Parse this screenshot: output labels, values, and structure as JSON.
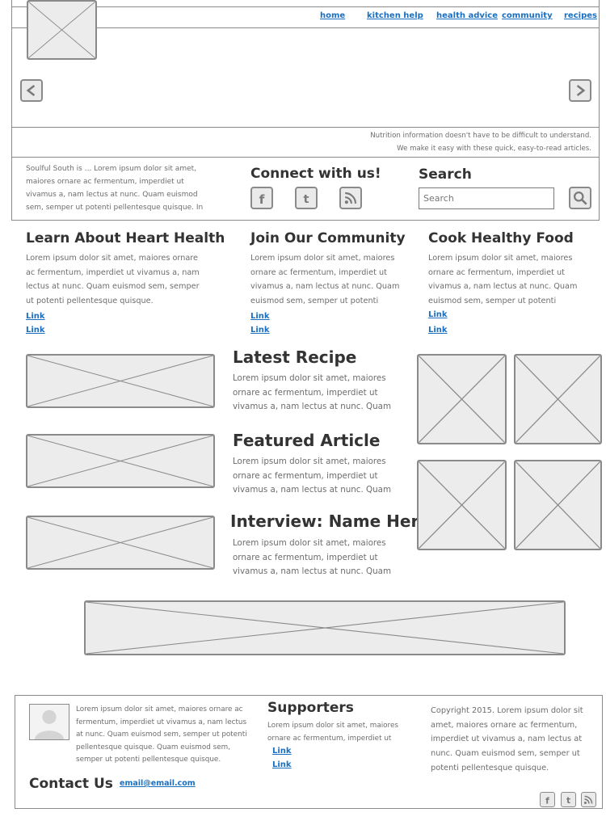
{
  "nav": {
    "home": "home",
    "kitchen_help": "kitchen help",
    "health_advice": "health advice",
    "community": "community",
    "recipes": "recipes"
  },
  "hero": {
    "prev_icon": "chevron-left-icon",
    "next_icon": "chevron-right-icon"
  },
  "tagline": {
    "line1": "Nutrition information doesn't have to be difficult to understand.",
    "line2": "We make it easy with these quick, easy-to-read articles."
  },
  "about": {
    "text": "Soulful South is ... Lorem ipsum dolor sit amet, maiores ornare ac fermentum, imperdiet ut vivamus a, nam lectus at nunc. Quam euismod sem, semper ut potenti pellentesque quisque. In eget"
  },
  "connect": {
    "title": "Connect with us!",
    "icons": [
      "facebook-icon",
      "twitter-icon",
      "rss-icon"
    ]
  },
  "search": {
    "title": "Search",
    "placeholder": "Search",
    "icon": "search-icon"
  },
  "features": [
    {
      "title": "Learn About Heart Health",
      "text": "Lorem ipsum dolor sit amet, maiores ornare ac fermentum, imperdiet ut vivamus a, nam lectus at nunc. Quam euismod sem, semper ut potenti pellentesque quisque.",
      "link1": "Link",
      "link2": "Link"
    },
    {
      "title": "Join Our Community",
      "text": "Lorem ipsum dolor sit amet, maiores ornare ac fermentum, imperdiet ut vivamus a, nam lectus at nunc. Quam euismod sem, semper ut potenti",
      "link1": "Link",
      "link2": "Link"
    },
    {
      "title": "Cook Healthy Food",
      "text": "Lorem ipsum dolor sit amet, maiores ornare ac fermentum, imperdiet ut vivamus a, nam lectus at nunc. Quam euismod sem, semper ut potenti",
      "link1": "Link",
      "link2": "Link"
    }
  ],
  "articles": [
    {
      "title": "Latest Recipe",
      "text": "Lorem ipsum dolor sit amet, maiores ornare ac fermentum, imperdiet ut vivamus a, nam lectus at nunc. Quam"
    },
    {
      "title": "Featured Article",
      "text": "Lorem ipsum dolor sit amet, maiores ornare ac fermentum, imperdiet ut vivamus a, nam lectus at nunc. Quam"
    },
    {
      "title": "Interview: Name Here",
      "text": "Lorem ipsum dolor sit amet, maiores ornare ac fermentum, imperdiet ut vivamus a, nam lectus at nunc. Quam"
    }
  ],
  "footer": {
    "bio": "Lorem ipsum dolor sit amet, maiores ornare ac fermentum, imperdiet ut vivamus a, nam lectus at nunc. Quam euismod sem, semper ut potenti pellentesque quisque. Quam euismod sem, semper ut potenti pellentesque quisque.",
    "contact_title": "Contact Us",
    "email": "email@email.com",
    "supporters_title": "Supporters",
    "supporters_text": "Lorem ipsum dolor sit amet, maiores ornare ac fermentum, imperdiet ut",
    "supporters_link1": "Link",
    "supporters_link2": "Link",
    "copyright": "Copyright 2015. Lorem ipsum dolor sit amet, maiores ornare ac fermentum, imperdiet ut vivamus a, nam lectus at nunc. Quam euismod sem, semper ut potenti pellentesque quisque.",
    "social_icons": [
      "facebook-icon",
      "twitter-icon",
      "rss-icon"
    ]
  },
  "colors": {
    "link": "#1a6fc0",
    "border": "#8a8a8a",
    "placeholder_fill": "#ececec",
    "body_text": "#6d6d6d"
  }
}
